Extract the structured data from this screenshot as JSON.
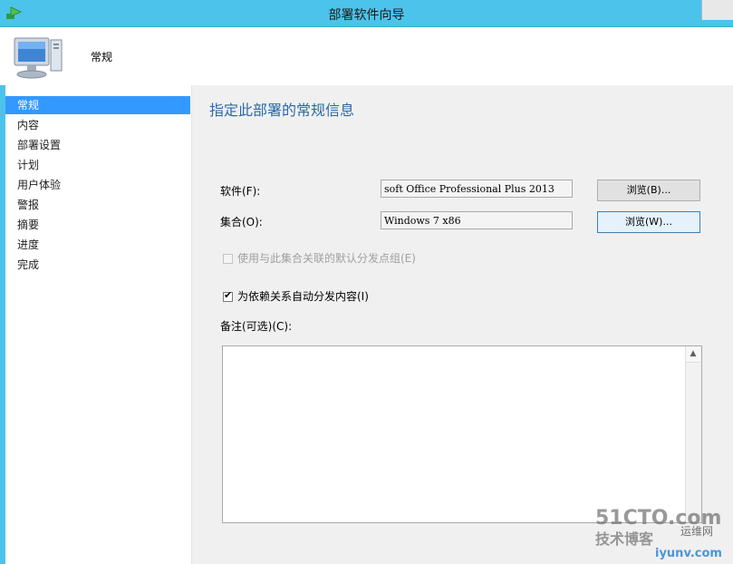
{
  "window": {
    "title": "部署软件向导"
  },
  "header": {
    "title": "常规"
  },
  "nav": {
    "items": [
      {
        "label": "常规",
        "active": true
      },
      {
        "label": "内容"
      },
      {
        "label": "部署设置"
      },
      {
        "label": "计划"
      },
      {
        "label": "用户体验"
      },
      {
        "label": "警报"
      },
      {
        "label": "摘要"
      },
      {
        "label": "进度"
      },
      {
        "label": "完成"
      }
    ]
  },
  "main": {
    "heading": "指定此部署的常规信息",
    "software": {
      "label": "软件(F):",
      "value": "soft Office Professional Plus 2013",
      "browse_label": "浏览(B)..."
    },
    "collection": {
      "label": "集合(O):",
      "value": "Windows 7 x86",
      "browse_label": "浏览(W)..."
    },
    "default_dp_checkbox": {
      "label": "使用与此集合关联的默认分发点组(E)",
      "checked": false,
      "enabled": false
    },
    "auto_distribute_checkbox": {
      "label": "为依赖关系自动分发内容(I)",
      "checked": true,
      "enabled": true
    },
    "comments": {
      "label": "备注(可选)(C):",
      "value": ""
    }
  },
  "watermark": {
    "line1": "51CTO.com",
    "line2": "技术博客",
    "line3": "运维网",
    "line4": "iyunv.com"
  }
}
